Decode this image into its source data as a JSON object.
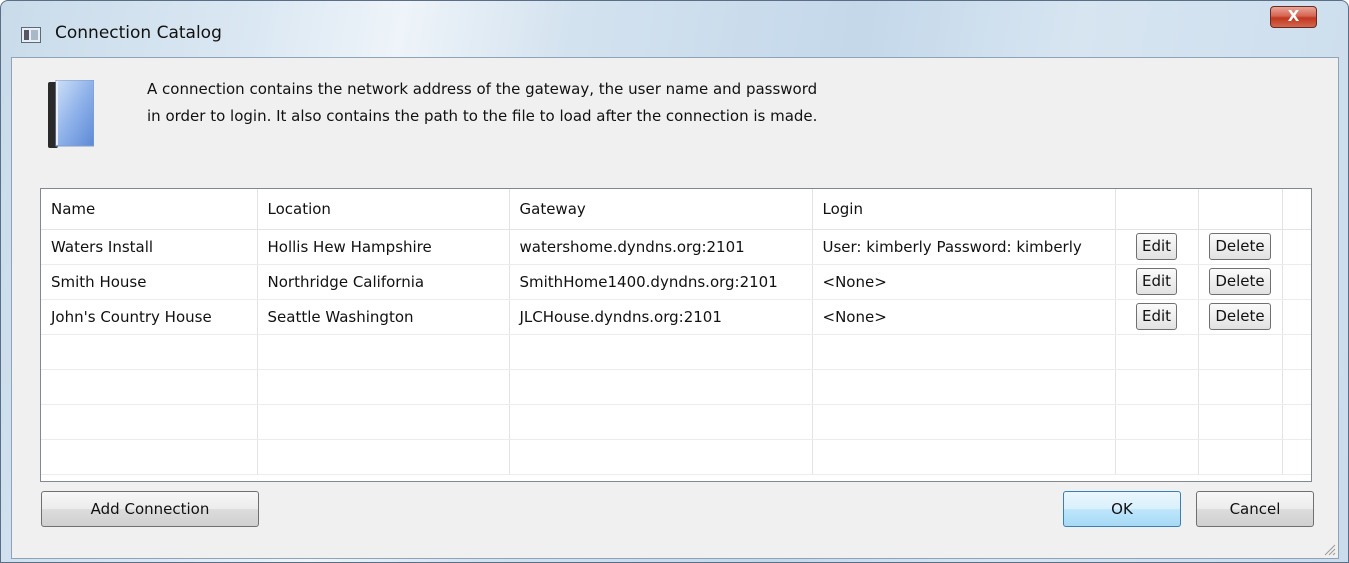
{
  "window": {
    "title": "Connection Catalog",
    "close_symbol": "X"
  },
  "description": "A connection contains the network address of the gateway, the user name and password in order to login. It also contains the path to the file to load after the connection is made.",
  "table": {
    "columns": [
      "Name",
      "Location",
      "Gateway",
      "Login",
      "",
      ""
    ],
    "rows": [
      {
        "name": "Waters Install",
        "location": "Hollis Hew Hampshire",
        "gateway": "watershome.dyndns.org:2101",
        "login": "User: kimberly Password: kimberly",
        "edit": "Edit",
        "delete": "Delete"
      },
      {
        "name": "Smith House",
        "location": "Northridge California",
        "gateway": "SmithHome1400.dyndns.org:2101",
        "login": "<None>",
        "edit": "Edit",
        "delete": "Delete"
      },
      {
        "name": "John's Country House",
        "location": "Seattle Washington",
        "gateway": "JLCHouse.dyndns.org:2101",
        "login": "<None>",
        "edit": "Edit",
        "delete": "Delete"
      }
    ]
  },
  "buttons": {
    "add_connection": "Add Connection",
    "ok": "OK",
    "cancel": "Cancel"
  },
  "icons": {
    "title_icon": "window-app-icon",
    "book_icon": "book-icon"
  }
}
